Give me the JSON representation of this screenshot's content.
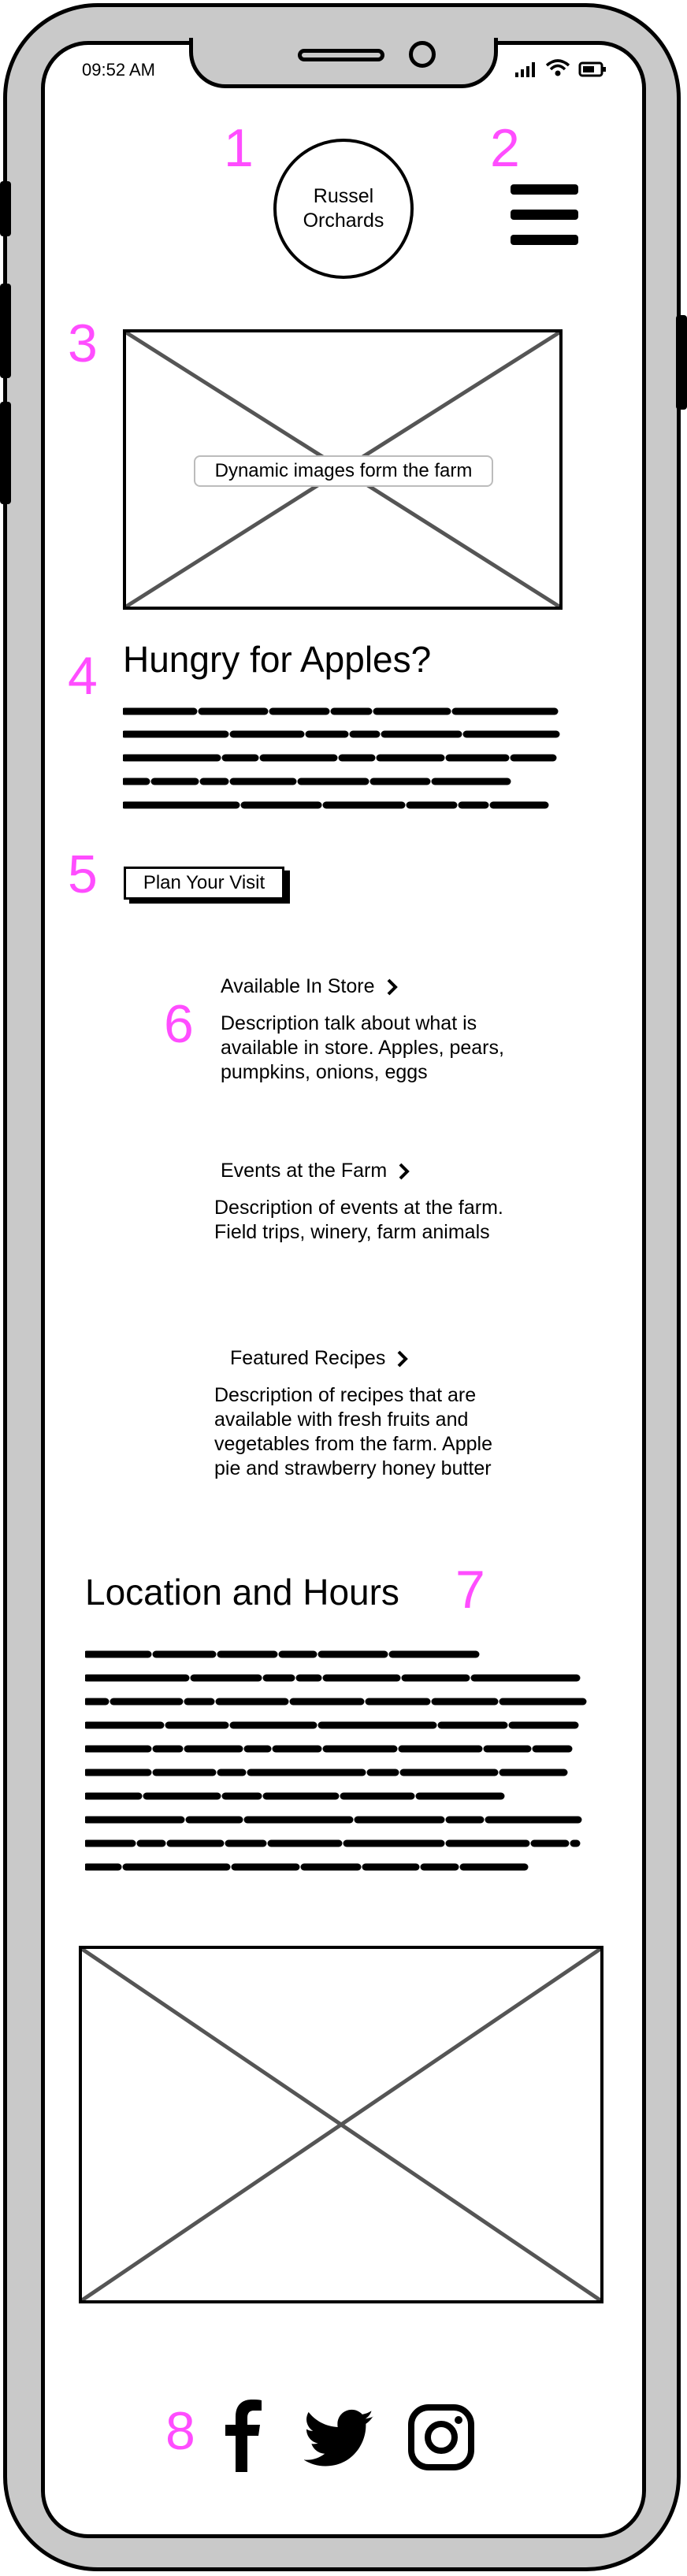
{
  "status_bar": {
    "time": "09:52 AM"
  },
  "annotations": [
    "1",
    "2",
    "3",
    "4",
    "5",
    "6",
    "7",
    "8"
  ],
  "header": {
    "logo_line1": "Russel",
    "logo_line2": "Orchards"
  },
  "hero": {
    "caption": "Dynamic images form the farm"
  },
  "intro": {
    "title": "Hungry for Apples?"
  },
  "cta": {
    "label": "Plan Your Visit"
  },
  "features": [
    {
      "title": "Available In Store",
      "description": "Description talk about what is available in store. Apples, pears, pumpkins, onions, eggs"
    },
    {
      "title": "Events at the Farm",
      "description": "Description of events at the farm. Field trips, winery, farm animals"
    },
    {
      "title": "Featured Recipes",
      "description": "Description of recipes that are available with fresh fruits and vegetables from the farm. Apple pie and strawberry honey butter"
    }
  ],
  "location": {
    "title": "Location and Hours"
  },
  "icons": [
    "signal-icon",
    "wifi-icon",
    "battery-icon",
    "menu-icon",
    "chevron-right-icon",
    "facebook-icon",
    "twitter-icon",
    "instagram-icon"
  ]
}
